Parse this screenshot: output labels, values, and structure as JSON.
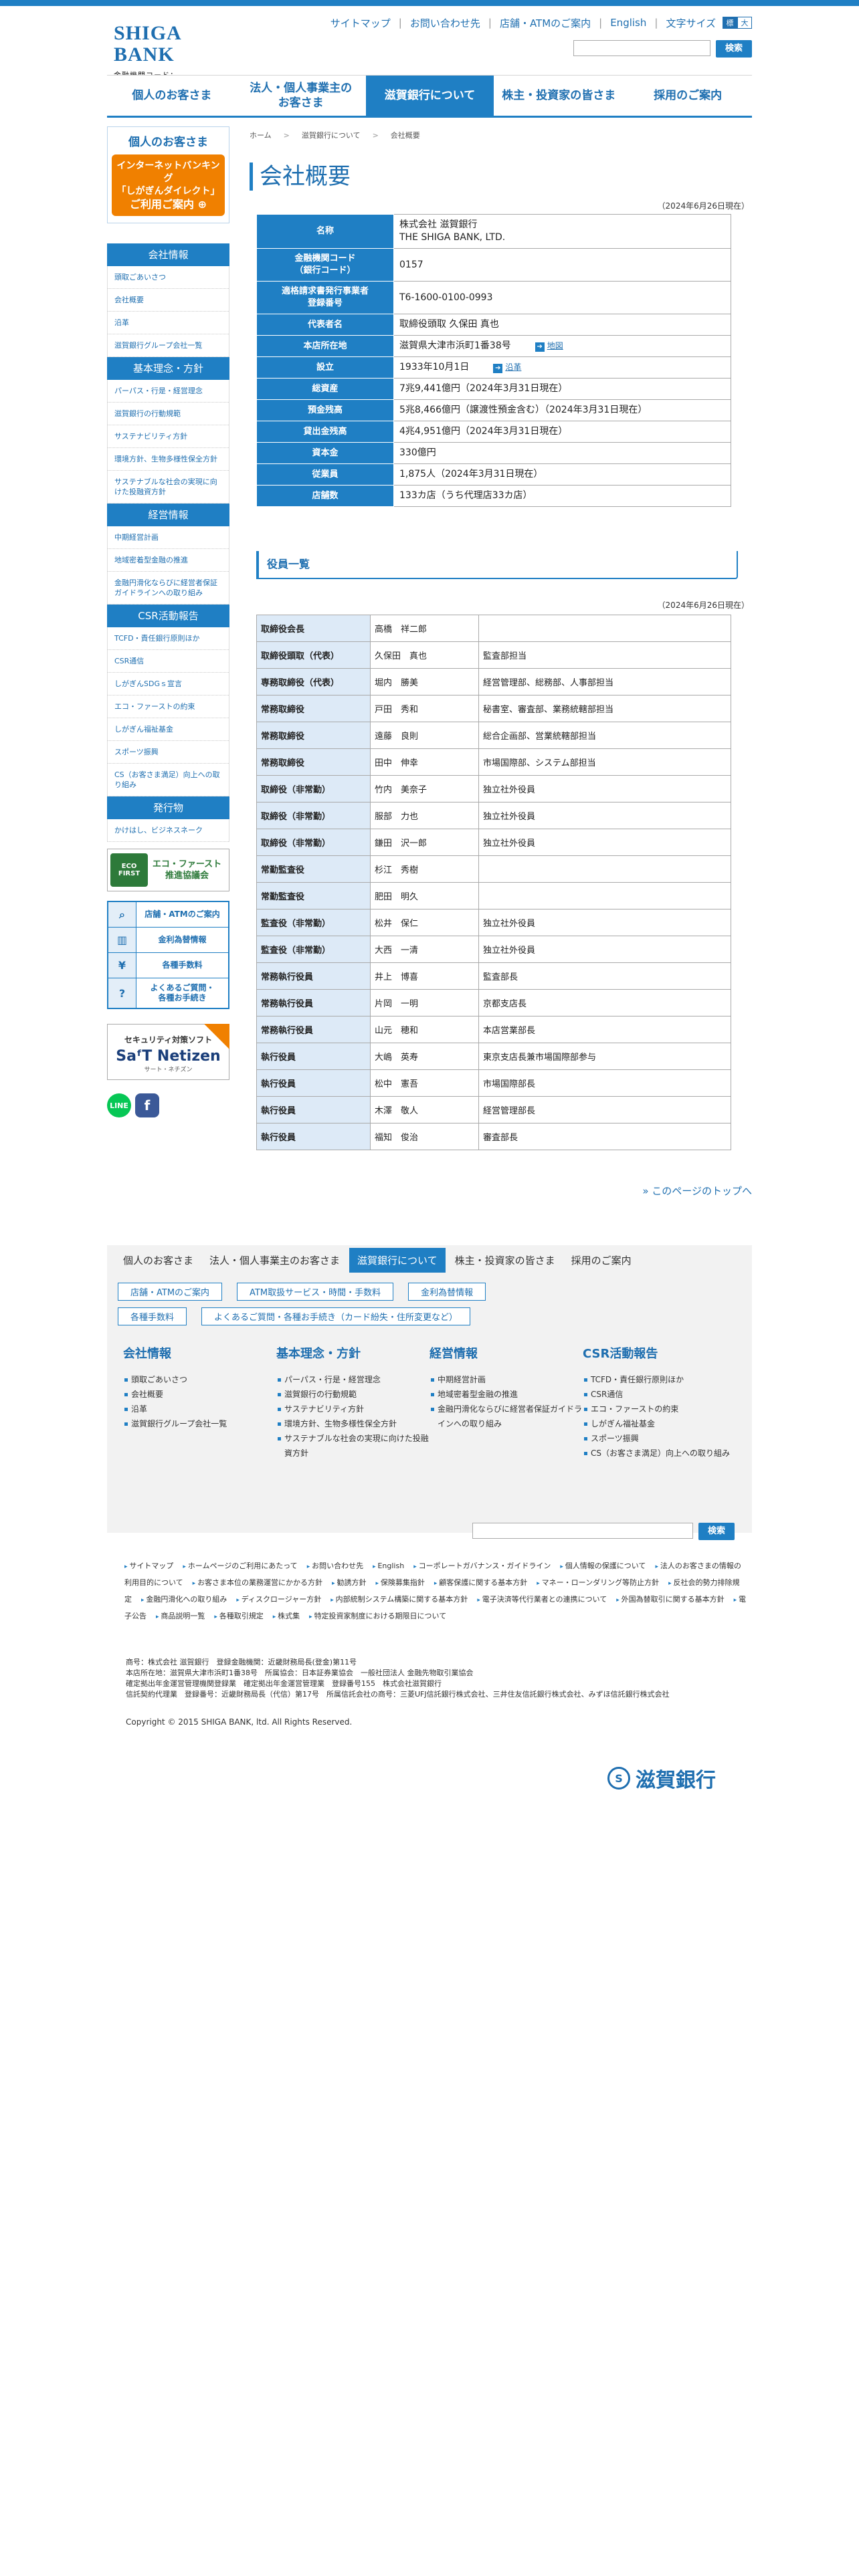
{
  "header": {
    "logo": "SHIGA BANK",
    "bank_code": "金融機関コード：0157",
    "util": [
      "サイトマップ",
      "お問い合わせ先",
      "店舗・ATMのご案内",
      "English",
      "文字サイズ"
    ],
    "size_std": "標準",
    "size_large": "大",
    "search_btn": "検索"
  },
  "gnav": [
    "個人のお客さま",
    "法人・個人事業主の\nお客さま",
    "滋賀銀行について",
    "株主・投資家の皆さま",
    "採用のご案内"
  ],
  "sidebar": {
    "box_title": "個人のお客さま",
    "ib_line1": "インターネットバンキング",
    "ib_line2": "「しがぎんダイレクト」",
    "ib_line3": "ご利用ご案内 ⊕",
    "sections": [
      {
        "title": "会社情報",
        "items": [
          "頭取ごあいさつ",
          "会社概要",
          "沿革",
          "滋賀銀行グループ会社一覧"
        ]
      },
      {
        "title": "基本理念・方針",
        "items": [
          "パーパス・行是・経営理念",
          "滋賀銀行の行動規範",
          "サステナビリティ方針",
          "環境方針、生物多様性保全方針",
          "サステナブルな社会の実現に向けた投融資方針"
        ]
      },
      {
        "title": "経営情報",
        "items": [
          "中期経営計画",
          "地域密着型金融の推進",
          "金融円滑化ならびに経営者保証ガイドラインへの取り組み"
        ]
      },
      {
        "title": "CSR活動報告",
        "items": [
          "TCFD・責任銀行原則ほか",
          "CSR通信",
          "しがぎんSDGｓ宣言",
          "エコ・ファーストの約束",
          "しがぎん福祉基金",
          "スポーツ振興",
          "CS（お客さま満足）向上への取り組み"
        ]
      },
      {
        "title": "発行物",
        "items": [
          "かけはし、ビジネスネーク"
        ]
      }
    ],
    "eco_badge": "ECO FIRST",
    "eco_text": "エコ・ファースト\n推進協議会",
    "quick": [
      "店舗・ATMのご案内",
      "金利為替情報",
      "各種手数料",
      "よくあるご質問・\n各種お手続き"
    ],
    "sec_t1": "セキュリティ対策ソフト",
    "sec_t2": "SaᶠT Netizen",
    "sec_t3": "サート・ネチズン",
    "line": "LINE",
    "fb": "f"
  },
  "breadcrumb": [
    "ホーム",
    "滋賀銀行について",
    "会社概要"
  ],
  "page_title": "会社概要",
  "overview_date": "（2024年6月26日現在）",
  "overview": [
    {
      "k": "名称",
      "v": "株式会社 滋賀銀行\nTHE SHIGA BANK, LTD."
    },
    {
      "k": "金融機関コード\n（銀行コード）",
      "v": "0157"
    },
    {
      "k": "適格請求書発行事業者\n登録番号",
      "v": "T6-1600-0100-0993"
    },
    {
      "k": "代表者名",
      "v": "取締役頭取 久保田 真也"
    },
    {
      "k": "本店所在地",
      "v": "滋賀県大津市浜町1番38号",
      "link": "地図"
    },
    {
      "k": "設立",
      "v": "1933年10月1日",
      "link": "沿革"
    },
    {
      "k": "総資産",
      "v": "7兆9,441億円（2024年3月31日現在）"
    },
    {
      "k": "預金残高",
      "v": "5兆8,466億円（譲渡性預金含む）（2024年3月31日現在）"
    },
    {
      "k": "貸出金残高",
      "v": "4兆4,951億円（2024年3月31日現在）"
    },
    {
      "k": "資本金",
      "v": "330億円"
    },
    {
      "k": "従業員",
      "v": "1,875人（2024年3月31日現在）"
    },
    {
      "k": "店舗数",
      "v": "133カ店（うち代理店33カ店）"
    }
  ],
  "officers_title": "役員一覧",
  "officers_date": "（2024年6月26日現在）",
  "officers": [
    {
      "r": "取締役会長",
      "n": "高橋　祥二郎",
      "d": ""
    },
    {
      "r": "取締役頭取（代表）",
      "n": "久保田　真也",
      "d": "監査部担当"
    },
    {
      "r": "専務取締役（代表）",
      "n": "堀内　勝美",
      "d": "経営管理部、総務部、人事部担当"
    },
    {
      "r": "常務取締役",
      "n": "戸田　秀和",
      "d": "秘書室、審査部、業務統轄部担当"
    },
    {
      "r": "常務取締役",
      "n": "遠藤　良則",
      "d": "総合企画部、営業統轄部担当"
    },
    {
      "r": "常務取締役",
      "n": "田中　伸幸",
      "d": "市場国際部、システム部担当"
    },
    {
      "r": "取締役（非常勤）",
      "n": "竹内　美奈子",
      "d": "独立社外役員"
    },
    {
      "r": "取締役（非常勤）",
      "n": "服部　力也",
      "d": "独立社外役員"
    },
    {
      "r": "取締役（非常勤）",
      "n": "鎌田　沢一郎",
      "d": "独立社外役員"
    },
    {
      "r": "常勤監査役",
      "n": "杉江　秀樹",
      "d": ""
    },
    {
      "r": "常勤監査役",
      "n": "肥田　明久",
      "d": ""
    },
    {
      "r": "監査役（非常勤）",
      "n": "松井　保仁",
      "d": "独立社外役員"
    },
    {
      "r": "監査役（非常勤）",
      "n": "大西　一清",
      "d": "独立社外役員"
    },
    {
      "r": "常務執行役員",
      "n": "井上　博喜",
      "d": "監査部長"
    },
    {
      "r": "常務執行役員",
      "n": "片岡　一明",
      "d": "京都支店長"
    },
    {
      "r": "常務執行役員",
      "n": "山元　穂和",
      "d": "本店営業部長"
    },
    {
      "r": "執行役員",
      "n": "大嶋　英寿",
      "d": "東京支店長兼市場国際部参与"
    },
    {
      "r": "執行役員",
      "n": "松中　憲吾",
      "d": "市場国際部長"
    },
    {
      "r": "執行役員",
      "n": "木澤　敬人",
      "d": "経営管理部長"
    },
    {
      "r": "執行役員",
      "n": "福知　俊治",
      "d": "審査部長"
    }
  ],
  "totop": "» このページのトップへ",
  "footer": {
    "nav": [
      "個人のお客さま",
      "法人・個人事業主のお客さま",
      "滋賀銀行について",
      "株主・投資家の皆さま",
      "採用のご案内"
    ],
    "buttons": [
      "店舗・ATMのご案内",
      "ATM取扱サービス・時間・手数料",
      "金利為替情報",
      "各種手数料",
      "よくあるご質問・各種お手続き（カード紛失・住所変更など）"
    ],
    "cols": [
      {
        "t": "会社情報",
        "items": [
          "頭取ごあいさつ",
          "会社概要",
          "沿革",
          "滋賀銀行グループ会社一覧"
        ]
      },
      {
        "t": "基本理念・方針",
        "items": [
          "パーパス・行是・経営理念",
          "滋賀銀行の行動規範",
          "サステナビリティ方針",
          "環境方針、生物多様性保全方針",
          "サステナブルな社会の実現に向けた投融資方針"
        ]
      },
      {
        "t": "経営情報",
        "items": [
          "中期経営計画",
          "地域密着型金融の推進",
          "金融円滑化ならびに経営者保証ガイドラインへの取り組み"
        ]
      },
      {
        "t": "CSR活動報告",
        "items": [
          "TCFD・責任銀行原則ほか",
          "CSR通信",
          "エコ・ファーストの約束",
          "しがぎん福祉基金",
          "スポーツ振興",
          "CS（お客さま満足）向上への取り組み"
        ]
      }
    ],
    "search_btn": "検索",
    "links": [
      "サイトマップ",
      "ホームページのご利用にあたって",
      "お問い合わせ先",
      "English",
      "コーポレートガバナンス・ガイドライン",
      "個人情報の保護について",
      "法人のお客さまの情報の利用目的について",
      "お客さま本位の業務運営にかかる方針",
      "勧誘方針",
      "保険募集指針",
      "顧客保護に関する基本方針",
      "マネー・ローンダリング等防止方針",
      "反社会的勢力排除規定",
      "金融円滑化への取り組み",
      "ディスクロージャー方針",
      "内部統制システム構築に関する基本方針",
      "電子決済等代行業者との連携について",
      "外国為替取引に関する基本方針",
      "電子公告",
      "商品説明一覧",
      "各種取引規定",
      "株式集",
      "特定投資家制度における期限日について"
    ],
    "legal1": "商号：株式会社 滋賀銀行　登録金融機関：近畿財務局長(登金)第11号",
    "legal2": "本店所在地：滋賀県大津市浜町1番38号　所属協会：日本証券業協会　一般社団法人 金融先物取引業協会",
    "legal3": "確定拠出年金運営管理機関登録業　確定拠出年金運営管理業　登録番号155　株式会社滋賀銀行",
    "legal4": "信託契約代理業　登録番号：近畿財務局長（代信）第17号　所属信託会社の商号：三菱UFJ信託銀行株式会社、三井住友信託銀行株式会社、みずほ信託銀行株式会社",
    "copyright": "Copyright © 2015 SHIGA BANK, ltd. All Rights Reserved.",
    "logo_mark": "S",
    "logo_name": "滋賀銀行"
  }
}
